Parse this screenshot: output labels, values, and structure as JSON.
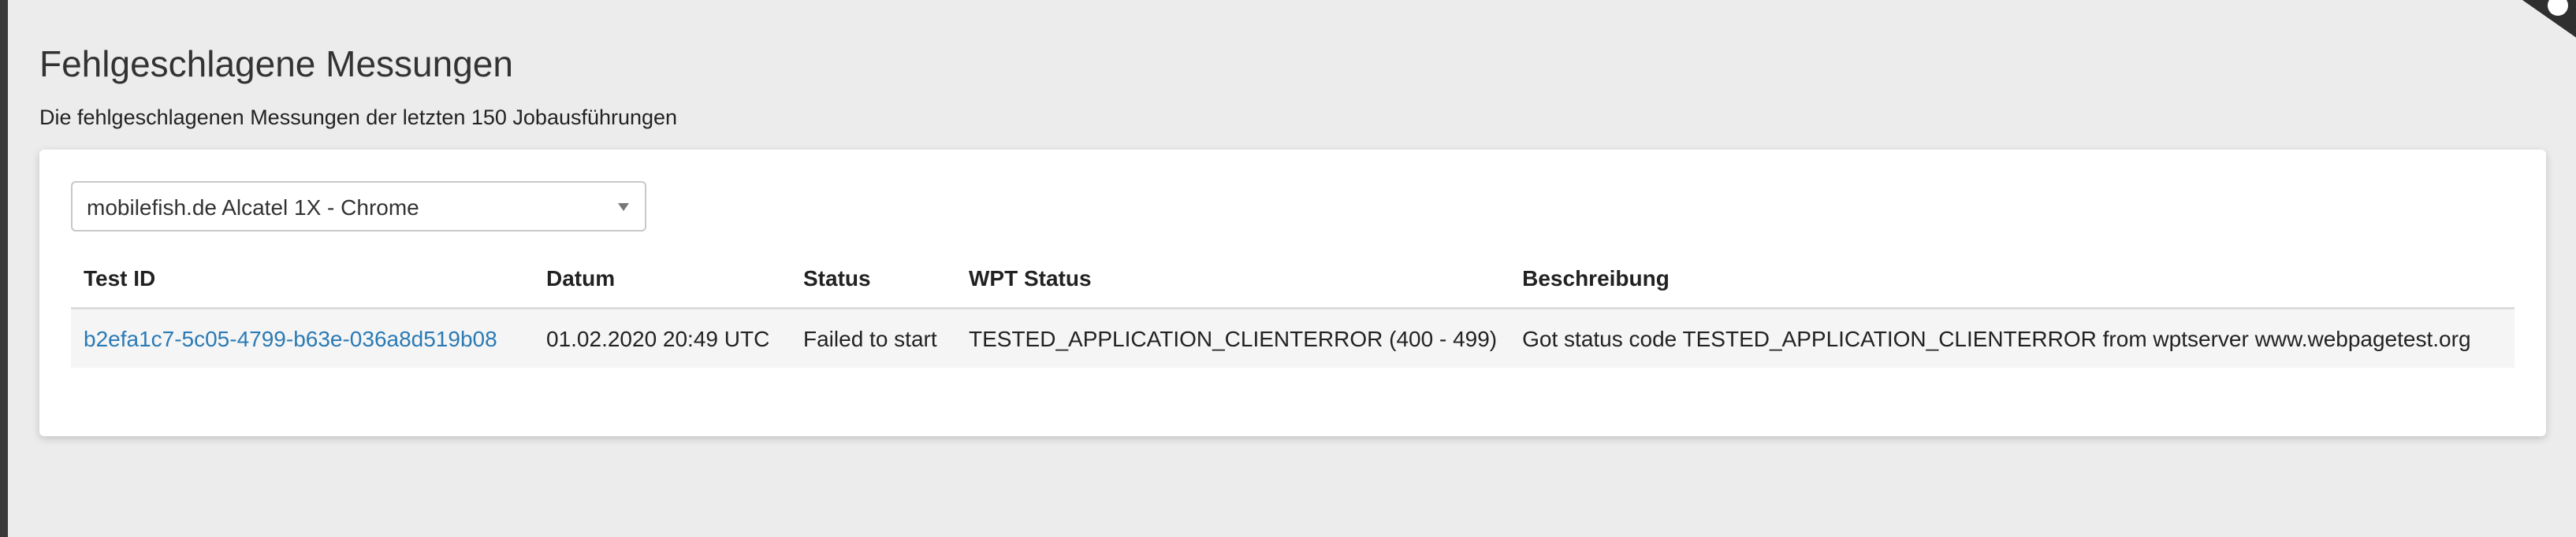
{
  "page": {
    "title": "Fehlgeschlagene Messungen",
    "subtitle": "Die fehlgeschlagenen Messungen der letzten 150 Jobausführungen"
  },
  "filter": {
    "selected": "mobilefish.de Alcatel 1X - Chrome"
  },
  "table": {
    "headers": [
      "Test ID",
      "Datum",
      "Status",
      "WPT Status",
      "Beschreibung"
    ],
    "rows": [
      {
        "test_id": "b2efa1c7-5c05-4799-b63e-036a8d519b08",
        "date": "01.02.2020 20:49 UTC",
        "status": "Failed to start",
        "wpt_status": "TESTED_APPLICATION_CLIENTERROR (400 - 499)",
        "description": "Got status code TESTED_APPLICATION_CLIENTERROR from wptserver www.webpagetest.org"
      }
    ]
  },
  "colors": {
    "background": "#ececec",
    "card": "#ffffff",
    "link": "#2a7ab5",
    "row_background": "#f5f5f5"
  }
}
